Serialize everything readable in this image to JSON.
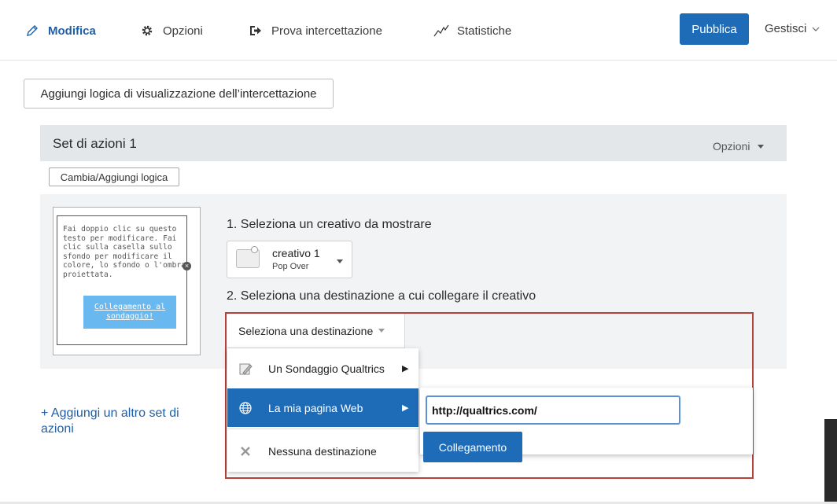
{
  "nav": {
    "items": [
      {
        "label": "Modifica",
        "icon": "pencil-icon",
        "active": true
      },
      {
        "label": "Opzioni",
        "icon": "gear-icon",
        "active": false
      },
      {
        "label": "Prova intercettazione",
        "icon": "arrow-in-icon",
        "active": false
      },
      {
        "label": "Statistiche",
        "icon": "chart-line-icon",
        "active": false
      }
    ],
    "publish": "Pubblica",
    "manage": "Gestisci"
  },
  "add_display_logic": "Aggiungi logica di visualizzazione dell’intercettazione",
  "action_set": {
    "title": "Set di azioni 1",
    "options": "Opzioni",
    "change_logic": "Cambia/Aggiungi logica",
    "preview_text": "Fai doppio clic su questo\ntesto per modificare. Fai\nclic sulla casella sullo\nsfondo per modificare il\ncolore, lo sfondo o l'ombra\nproiettata.",
    "preview_link": "Collegamento al sondaggio!",
    "step1": "1. Seleziona un creativo da mostrare",
    "creative_name": "creativo 1",
    "creative_type": "Pop Over",
    "step2": "2. Seleziona una destinazione a cui collegare il creativo",
    "destination_dropdown": "Seleziona una destinazione",
    "menu": [
      {
        "label": "Un Sondaggio Qualtrics",
        "icon": "survey-icon",
        "has_submenu": true
      },
      {
        "label": "La mia pagina Web",
        "icon": "globe-icon",
        "has_submenu": true,
        "selected": true
      },
      {
        "label": "Nessuna destinazione",
        "icon": "no-destination-icon",
        "has_submenu": false
      }
    ],
    "url_value": "http://qualtrics.com/",
    "link_button": "Collegamento"
  },
  "add_set": "+ Aggiungi un altro set di azioni",
  "colors": {
    "accent": "#1e6bb8",
    "highlight": "#b5423a",
    "header_bg": "#e4e7ea"
  }
}
